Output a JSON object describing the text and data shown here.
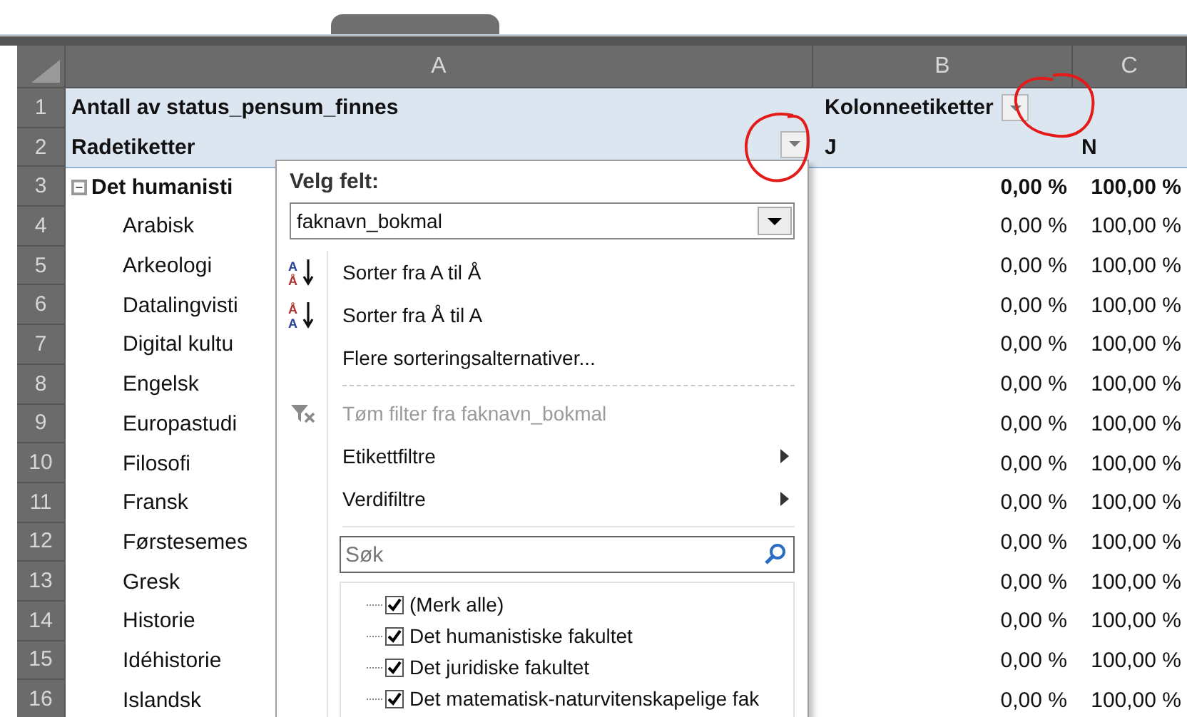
{
  "sheet": {
    "column_headers": [
      "A",
      "B",
      "C"
    ],
    "rows": [
      {
        "number": "1",
        "kind": "title",
        "a": "Antall av status_pensum_finnes",
        "b": "Kolonneetiketter",
        "a_filter": false,
        "b_filter": true
      },
      {
        "number": "2",
        "kind": "title",
        "a": "Radetiketter",
        "b": "J",
        "c": "N",
        "a_filter": true,
        "b_filter": false
      },
      {
        "number": "3",
        "kind": "group",
        "expanded": true,
        "a": "Det humanisti",
        "b": "0,00 %",
        "c": "100,00 %"
      },
      {
        "number": "4",
        "kind": "item",
        "a": "Arabisk",
        "b": "0,00 %",
        "c": "100,00 %"
      },
      {
        "number": "5",
        "kind": "item",
        "a": "Arkeologi",
        "b": "0,00 %",
        "c": "100,00 %"
      },
      {
        "number": "6",
        "kind": "item",
        "a": "Datalingvisti",
        "b": "0,00 %",
        "c": "100,00 %"
      },
      {
        "number": "7",
        "kind": "item",
        "a": "Digital kultu",
        "b": "0,00 %",
        "c": "100,00 %"
      },
      {
        "number": "8",
        "kind": "item",
        "a": "Engelsk",
        "b": "0,00 %",
        "c": "100,00 %"
      },
      {
        "number": "9",
        "kind": "item",
        "a": "Europastudi",
        "b": "0,00 %",
        "c": "100,00 %"
      },
      {
        "number": "10",
        "kind": "item",
        "a": "Filosofi",
        "b": "0,00 %",
        "c": "100,00 %"
      },
      {
        "number": "11",
        "kind": "item",
        "a": "Fransk",
        "b": "0,00 %",
        "c": "100,00 %"
      },
      {
        "number": "12",
        "kind": "item",
        "a": "Førstesemes",
        "b": "0,00 %",
        "c": "100,00 %"
      },
      {
        "number": "13",
        "kind": "item",
        "a": "Gresk",
        "b": "0,00 %",
        "c": "100,00 %"
      },
      {
        "number": "14",
        "kind": "item",
        "a": "Historie",
        "b": "0,00 %",
        "c": "100,00 %"
      },
      {
        "number": "15",
        "kind": "item",
        "a": "Idéhistorie",
        "b": "0,00 %",
        "c": "100,00 %"
      },
      {
        "number": "16",
        "kind": "item",
        "a": "Islandsk",
        "b": "0,00 %",
        "c": "100,00 %"
      }
    ]
  },
  "filter_menu": {
    "field_label": "Velg felt:",
    "field_value": "faknavn_bokmal",
    "items": [
      {
        "kind": "sort_asc",
        "label": "Sorter fra A til Å",
        "icon_letters": [
          "A",
          "Å"
        ],
        "disabled": false
      },
      {
        "kind": "sort_desc",
        "label": "Sorter fra Å til A",
        "icon_letters": [
          "Å",
          "A"
        ],
        "disabled": false
      },
      {
        "kind": "plain",
        "label": "Flere sorteringsalternativer...",
        "disabled": false
      },
      {
        "kind": "separator",
        "disabled": false
      },
      {
        "kind": "clear_filter",
        "label": "Tøm filter fra faknavn_bokmal",
        "disabled": true
      },
      {
        "kind": "submenu",
        "label": "Etikettfiltre",
        "disabled": false
      },
      {
        "kind": "submenu",
        "label": "Verdifiltre",
        "disabled": false
      }
    ],
    "search": {
      "placeholder": "Søk"
    },
    "checklist": [
      {
        "label": "(Merk alle)",
        "checked": true
      },
      {
        "label": "Det humanistiske fakultet",
        "checked": true
      },
      {
        "label": "Det juridiske fakultet",
        "checked": true
      },
      {
        "label": "Det matematisk-naturvitenskapelige fak",
        "checked": true
      }
    ]
  }
}
